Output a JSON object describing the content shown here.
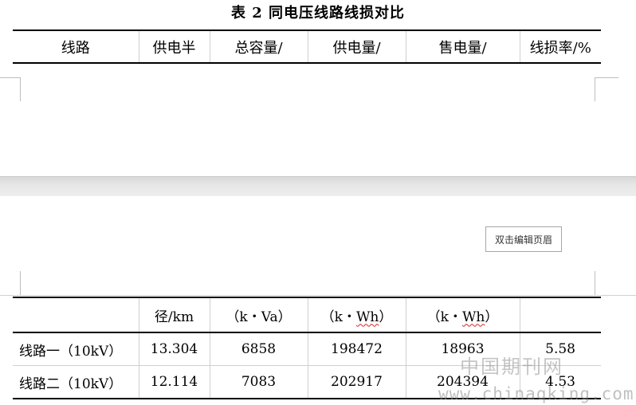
{
  "title": "表 2 同电压线路线损对比",
  "header": [
    "线路",
    "供电半",
    "总容量/",
    "供电量/",
    "售电量/",
    "线损率/%"
  ],
  "units": {
    "line": "",
    "radius": "径/km",
    "capacity": "（k・Va）",
    "supply_prefix": "（k・",
    "supply_wavy": "Wh",
    "supply_suffix": "）",
    "sold_prefix": "（k・",
    "sold_wavy": "Wh",
    "sold_suffix": "）",
    "loss": ""
  },
  "rows": [
    {
      "line": "线路一（10kV）",
      "radius": "13.304",
      "capacity": "6858",
      "supply": "198472",
      "sold": "18963",
      "loss": "5.58"
    },
    {
      "line": "线路二（10kV）",
      "radius": "12.114",
      "capacity": "7083",
      "supply": "202917",
      "sold": "204394",
      "loss": "4.53"
    }
  ],
  "edit_header_button": "双击编辑页眉",
  "watermark": {
    "cn": "中国期刊网",
    "url": "www.chinaqking.com"
  }
}
